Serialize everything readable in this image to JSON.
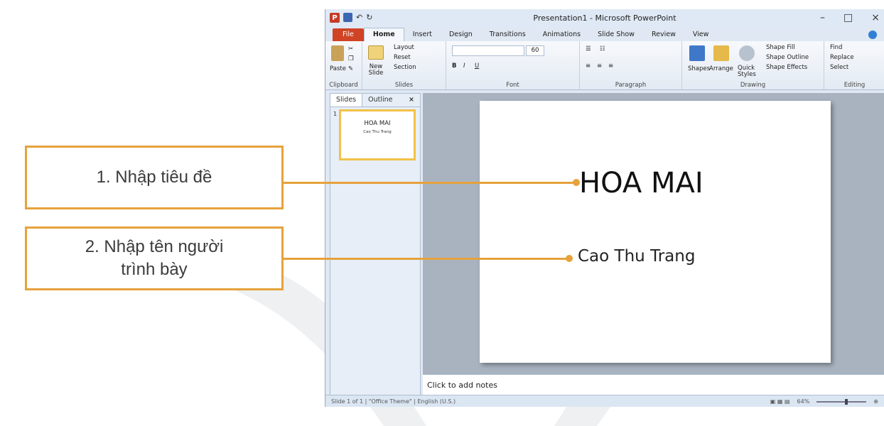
{
  "callouts": [
    {
      "label": "1. Nhập tiêu đề"
    },
    {
      "label_line1": "2. Nhập tên người",
      "label_line2": "trình bày"
    }
  ],
  "window": {
    "title": "Presentation1 - Microsoft PowerPoint",
    "app_icon": "P",
    "minimize": "–",
    "maximize": "□",
    "close": "×"
  },
  "ribbon_tabs": [
    "File",
    "Home",
    "Insert",
    "Design",
    "Transitions",
    "Animations",
    "Slide Show",
    "Review",
    "View"
  ],
  "ribbon": {
    "clipboard": {
      "paste": "Paste",
      "label": "Clipboard"
    },
    "slides": {
      "new_slide": "New Slide",
      "layout": "Layout",
      "reset": "Reset",
      "section": "Section",
      "label": "Slides"
    },
    "font": {
      "size": "60",
      "bold": "B",
      "italic": "I",
      "underline": "U",
      "label": "Font"
    },
    "paragraph": {
      "label": "Paragraph"
    },
    "drawing": {
      "shapes": "Shapes",
      "arrange": "Arrange",
      "quick_styles": "Quick Styles",
      "shape_fill": "Shape Fill",
      "shape_outline": "Shape Outline",
      "shape_effects": "Shape Effects",
      "label": "Drawing"
    },
    "editing": {
      "find": "Find",
      "replace": "Replace",
      "select": "Select",
      "label": "Editing"
    }
  },
  "panel": {
    "tabs": [
      "Slides",
      "Outline"
    ],
    "close": "×",
    "slide_number": "1",
    "thumb_title": "HOA MAI",
    "thumb_sub": "Cao Thu Trang"
  },
  "slide": {
    "title": "HOA MAI",
    "subtitle": "Cao Thu Trang"
  },
  "notes_placeholder": "Click to add notes",
  "status": {
    "slide": "Slide 1 of 1",
    "theme": "\"Office Theme\"",
    "language": "English (U.S.)",
    "zoom": "64%"
  },
  "colors": {
    "accent": "#e6a23c",
    "file_tab": "#d04425"
  }
}
